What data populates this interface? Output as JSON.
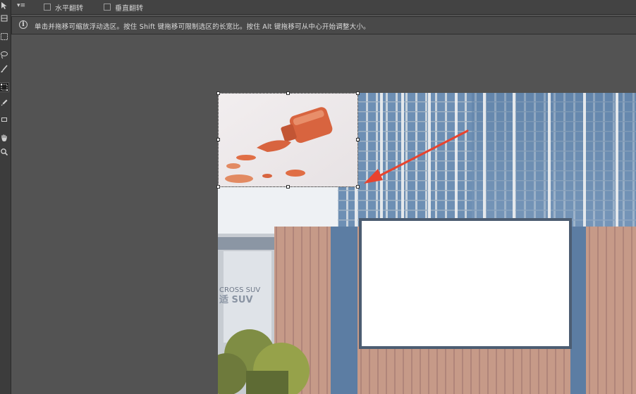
{
  "options_bar": {
    "preset_glyph": "▾≡",
    "flip_horizontal_label": "水平翻转",
    "flip_vertical_label": "垂直翻转"
  },
  "hint_bar": {
    "info_glyph": "i",
    "text": "单击并拖移可缩放浮动选区。按住 Shift 键拖移可限制选区的长宽比。按住 Alt 键拖移可从中心开始调整大小。"
  },
  "toolbar": {
    "tools": [
      "move-icon",
      "artboard-icon",
      "marquee-icon",
      "lasso-icon",
      "brush-icon",
      "transform-selection-icon",
      "eyedropper-icon",
      "stamp-icon",
      "hand-icon",
      "zoom-icon"
    ],
    "active_tool": "transform-selection-icon"
  },
  "canvas_image": {
    "sign_lines": [
      "CROSS SUV",
      "适 SUV"
    ],
    "billboard_color": "#ffffff",
    "accent_color": "#e8432e"
  },
  "floating_selection": {
    "subject": "orange nail polish bottle",
    "paint_color": "#d8643f"
  }
}
